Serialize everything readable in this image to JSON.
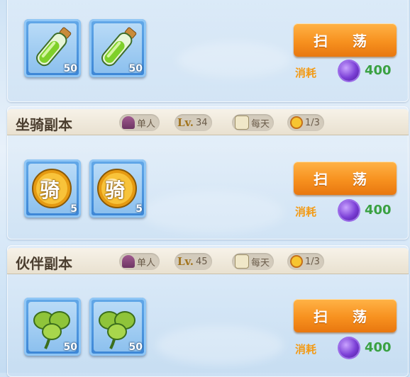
{
  "sections": [
    {
      "title": "",
      "items": [
        {
          "icon": "green-potion-icon",
          "count": "50"
        },
        {
          "icon": "green-potion-icon",
          "count": "50"
        }
      ],
      "sweep_label": "扫 荡",
      "cost_label": "消耗",
      "cost_value": "400"
    },
    {
      "title": "坐骑副本",
      "tags": {
        "players": "单人",
        "level_prefix": "Lv.",
        "level": "34",
        "frequency": "每天",
        "attempts": "1/3"
      },
      "items": [
        {
          "icon": "mount-coin-icon",
          "glyph": "骑",
          "count": "5"
        },
        {
          "icon": "mount-coin-icon",
          "glyph": "骑",
          "count": "5"
        }
      ],
      "sweep_label": "扫 荡",
      "cost_label": "消耗",
      "cost_value": "400"
    },
    {
      "title": "伙伴副本",
      "tags": {
        "players": "单人",
        "level_prefix": "Lv.",
        "level": "45",
        "frequency": "每天",
        "attempts": "1/3"
      },
      "items": [
        {
          "icon": "clover-icon",
          "count": "50"
        },
        {
          "icon": "clover-icon",
          "count": "50"
        }
      ],
      "sweep_label": "扫 荡",
      "cost_label": "消耗",
      "cost_value": "400"
    }
  ],
  "colors": {
    "accent_orange": "#f7911f",
    "cost_green": "#3aa142",
    "gem_purple": "#7b3fd6"
  }
}
